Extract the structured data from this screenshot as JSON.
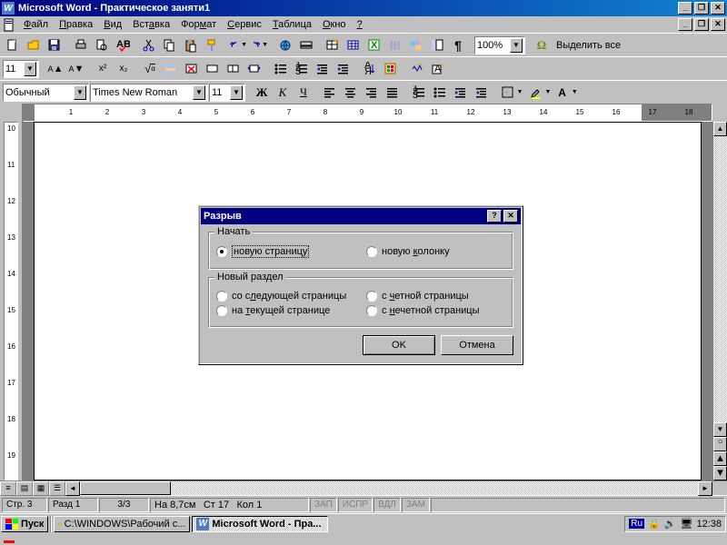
{
  "window": {
    "title": "Microsoft Word - Практическое заняти1"
  },
  "menu": {
    "file": "Файл",
    "edit": "Правка",
    "view": "Вид",
    "insert": "Вставка",
    "format": "Формат",
    "tools": "Сервис",
    "table": "Таблица",
    "window": "Окно",
    "help": "?"
  },
  "toolbar1": {
    "zoom": "100%",
    "select_all": "Выделить все"
  },
  "toolbar2": {
    "font_size": "11"
  },
  "format_bar": {
    "style": "Обычный",
    "font": "Times New Roman",
    "size": "11"
  },
  "ruler_h": {
    "dark_left_end": 0,
    "dark_right_start": 17,
    "ticks": [
      1,
      2,
      3,
      4,
      5,
      6,
      7,
      8,
      9,
      10,
      11,
      12,
      13,
      14,
      15,
      16,
      17,
      18
    ]
  },
  "ruler_v": {
    "ticks": [
      10,
      11,
      12,
      13,
      14,
      15,
      16,
      17,
      18,
      19
    ]
  },
  "status": {
    "page": "Стр. 3",
    "section": "Разд 1",
    "pages": "3/3",
    "at": "На 8,7см",
    "line": "Ст 17",
    "col": "Кол 1",
    "rec": "ЗАП",
    "trk": "ИСПР",
    "ext": "ВДЛ",
    "ovr": "ЗАМ"
  },
  "dialog": {
    "title": "Разрыв",
    "group1_legend": "Начать",
    "opt_newpage": "новую страницу",
    "opt_newcol": "новую колонку",
    "group2_legend": "Новый раздел",
    "opt_nextpage": "со следующей страницы",
    "opt_evenpage": "с четной страницы",
    "opt_curpage": "на текущей странице",
    "opt_oddpage": "с нечетной страницы",
    "ok": "OK",
    "cancel": "Отмена"
  },
  "taskbar": {
    "start": "Пуск",
    "task1": "C:\\WINDOWS\\Рабочий с...",
    "task2": "Microsoft Word - Пра...",
    "lang": "Ru",
    "clock": "12:38"
  }
}
